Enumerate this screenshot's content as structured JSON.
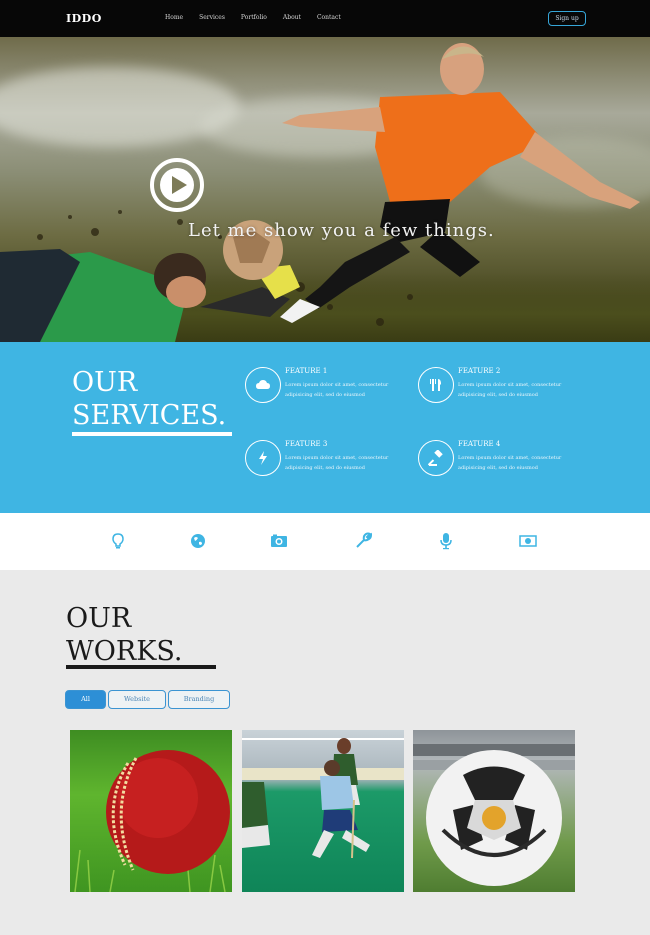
{
  "brand": {
    "logo": "IDDO"
  },
  "nav": {
    "items": [
      "Home",
      "Services",
      "Portfolio",
      "About",
      "Contact"
    ],
    "signup": "Sign up"
  },
  "hero": {
    "tagline": "Let me show you a few things."
  },
  "services": {
    "title_line1": "OUR",
    "title_line2": "SERVICES.",
    "features": [
      {
        "title": "FEATURE 1",
        "text": "Lorem ipsum dolor sit amet, consectetur adipisicing elit, sed do eiusmod",
        "icon": "cloud-icon"
      },
      {
        "title": "FEATURE 2",
        "text": "Lorem ipsum dolor sit amet, consectetur adipisicing elit, sed do eiusmod",
        "icon": "fork-knife-icon"
      },
      {
        "title": "FEATURE 3",
        "text": "Lorem ipsum dolor sit amet, consectetur adipisicing elit, sed do eiusmod",
        "icon": "lightning-icon"
      },
      {
        "title": "FEATURE 4",
        "text": "Lorem ipsum dolor sit amet, consectetur adipisicing elit, sed do eiusmod",
        "icon": "gavel-icon"
      }
    ]
  },
  "iconbar": {
    "icons": [
      "lightbulb-icon",
      "globe-icon",
      "camera-icon",
      "wrench-icon",
      "microphone-icon",
      "money-icon"
    ]
  },
  "works": {
    "title_line1": "OUR",
    "title_line2": "WORKS.",
    "filters": [
      {
        "label": "All",
        "active": true
      },
      {
        "label": "Website",
        "active": false
      },
      {
        "label": "Branding",
        "active": false
      }
    ],
    "items": [
      "cricket-ball-image",
      "field-hockey-image",
      "soccer-ball-image"
    ]
  },
  "colors": {
    "nav_bg": "#070707",
    "services_bg": "#3fb5e3",
    "accent_blue": "#2d8fd6",
    "works_bg": "#eaeaea"
  }
}
